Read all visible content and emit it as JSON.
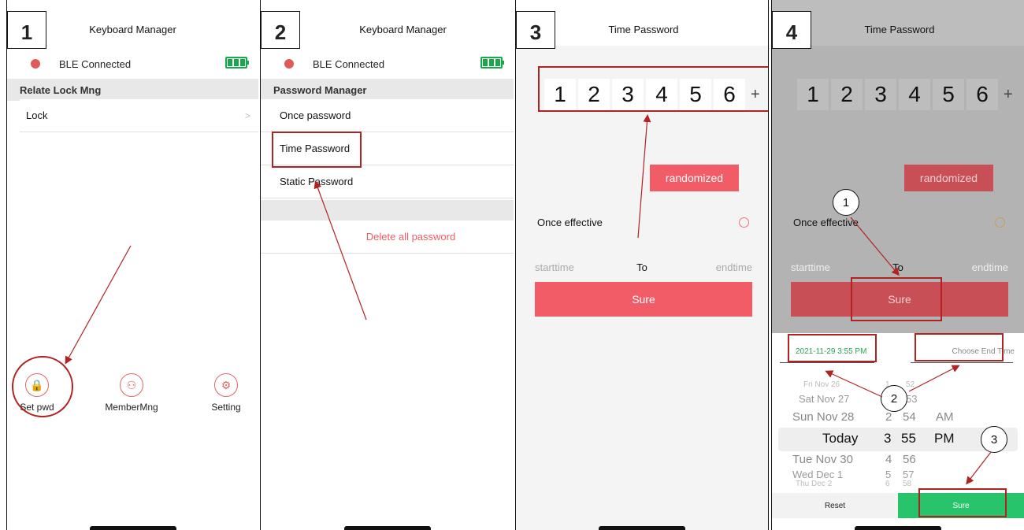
{
  "steps": [
    "1",
    "2",
    "3",
    "4"
  ],
  "panel1": {
    "title": "Keyboard Manager",
    "ble_status": "BLE Connected",
    "section": "Relate Lock Mng",
    "row": "Lock",
    "chevron": ">",
    "tabs": [
      {
        "label": "Set pwd",
        "icon": "lock-icon",
        "glyph": "🔒"
      },
      {
        "label": "MemberMng",
        "icon": "members-icon",
        "glyph": "⚇"
      },
      {
        "label": "Setting",
        "icon": "gear-icon",
        "glyph": "⚙"
      }
    ]
  },
  "panel2": {
    "title": "Keyboard Manager",
    "ble_status": "BLE Connected",
    "section": "Password Manager",
    "rows": [
      "Once password",
      "Time Password",
      "Static Password"
    ],
    "delete_all": "Delete all password"
  },
  "panel3": {
    "title": "Time Password",
    "digits": [
      "1",
      "2",
      "3",
      "4",
      "5",
      "6"
    ],
    "plus": "+",
    "randomize": "randomized",
    "once_effective": "Once effective",
    "starttime": "starttime",
    "to": "To",
    "endtime": "endtime",
    "sure": "Sure"
  },
  "panel4": {
    "title": "Time Password",
    "digits": [
      "1",
      "2",
      "3",
      "4",
      "5",
      "6"
    ],
    "plus": "+",
    "randomize": "randomized",
    "once_effective": "Once effective",
    "starttime": "starttime",
    "to": "To",
    "endtime": "endtime",
    "sure": "Sure",
    "start_value": "2021-11-29 3:55 PM",
    "end_placeholder": "Choose End Time",
    "wheel": [
      {
        "day": "Fri Nov 26",
        "hour": "1",
        "minute": "52",
        "ampm": ""
      },
      {
        "day": "Sat Nov 27",
        "hour": "1",
        "minute": "53",
        "ampm": ""
      },
      {
        "day": "Sun Nov 28",
        "hour": "2",
        "minute": "54",
        "ampm": "AM"
      },
      {
        "day": "Today",
        "hour": "3",
        "minute": "55",
        "ampm": "PM"
      },
      {
        "day": "Tue Nov 30",
        "hour": "4",
        "minute": "56",
        "ampm": ""
      },
      {
        "day": "Wed Dec 1",
        "hour": "5",
        "minute": "57",
        "ampm": ""
      },
      {
        "day": "Thu Dec 2",
        "hour": "6",
        "minute": "58",
        "ampm": ""
      }
    ],
    "reset": "Reset",
    "confirm": "Sure",
    "callouts": [
      "1",
      "2",
      "3"
    ]
  },
  "colors": {
    "accent_red": "#f25c66",
    "confirm_green": "#27c46b",
    "annotation_red": "#b22222",
    "battery_green": "#1aa84a"
  }
}
